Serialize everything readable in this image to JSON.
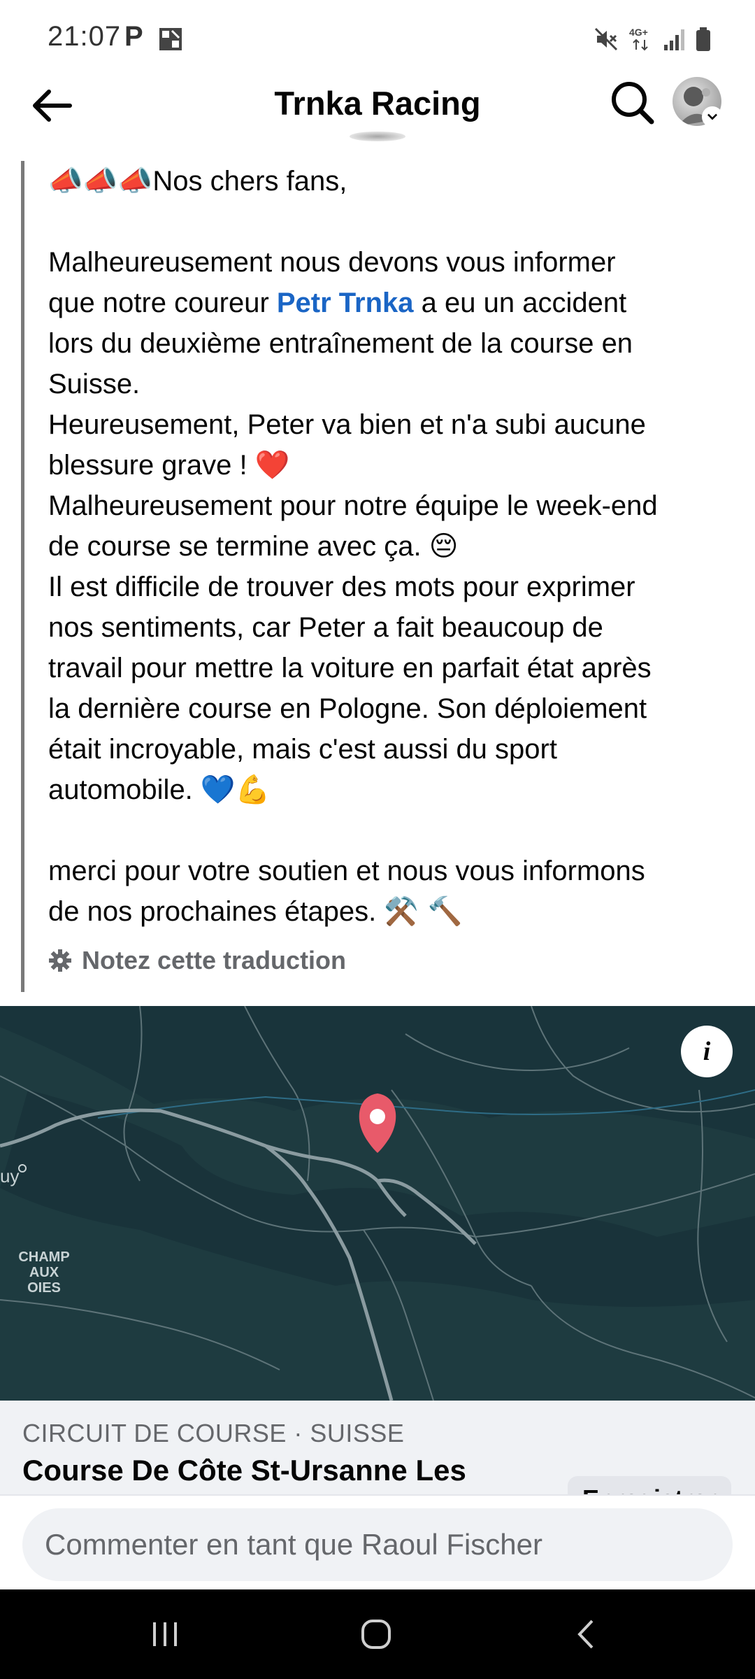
{
  "status_bar": {
    "time": "21:07",
    "p_icon": "P",
    "network": "4G+",
    "icons": [
      "parking-icon",
      "gallery-icon",
      "mute-icon",
      "network-icon",
      "signal-icon",
      "battery-icon"
    ]
  },
  "header": {
    "title": "Trnka Racing",
    "icons": [
      "back-arrow-icon",
      "search-icon",
      "profile-avatar"
    ]
  },
  "post": {
    "lines": [
      {
        "pre": "Nos chers fans,",
        "emoji_before": "📣📣📣"
      },
      {
        "pre": ""
      },
      {
        "pre": "Malheureusement nous devons vous informer"
      },
      {
        "pre": "que notre coureur ",
        "mention": "Petr Trnka",
        "post": " a eu un accident"
      },
      {
        "pre": "lors du deuxième entraînement de la course en"
      },
      {
        "pre": "Suisse."
      },
      {
        "pre": "Heureusement, Peter va bien et n'a subi aucune"
      },
      {
        "pre": "blessure grave ! ",
        "emoji_after": "❤️"
      },
      {
        "pre": "Malheureusement pour notre équipe le week-end"
      },
      {
        "pre": "de course se termine avec ça. ",
        "emoji_after": "😔"
      },
      {
        "pre": "Il est difficile de trouver des mots pour exprimer"
      },
      {
        "pre": "nos sentiments, car Peter a fait beaucoup de"
      },
      {
        "pre": "travail pour mettre la voiture en parfait état après"
      },
      {
        "pre": "la dernière course en Pologne. Son déploiement"
      },
      {
        "pre": "était incroyable, mais c'est aussi du sport"
      },
      {
        "pre": "automobile. ",
        "emoji_after": "💙💪"
      },
      {
        "pre": ""
      },
      {
        "pre": "merci pour votre soutien et nous vous informons"
      },
      {
        "pre": "de nos prochaines étapes. ",
        "emoji_after": "⚒️ 🔨"
      }
    ],
    "rate_translation": "Notez cette traduction"
  },
  "map": {
    "label_champ": "CHAMP",
    "label_oies": "AUX OIES",
    "label_edge": "uy",
    "info_glyph": "i"
  },
  "place": {
    "category": "CIRCUIT DE COURSE · SUISSE",
    "name": "Course De Côte St-Ursanne Les",
    "save_label": "Enregistrer"
  },
  "comment": {
    "placeholder": "Commenter en tant que Raoul Fischer"
  },
  "colors": {
    "accent_link": "#1a65c5",
    "map_bg": "#1e3b40",
    "pin": "#e85a6a"
  }
}
